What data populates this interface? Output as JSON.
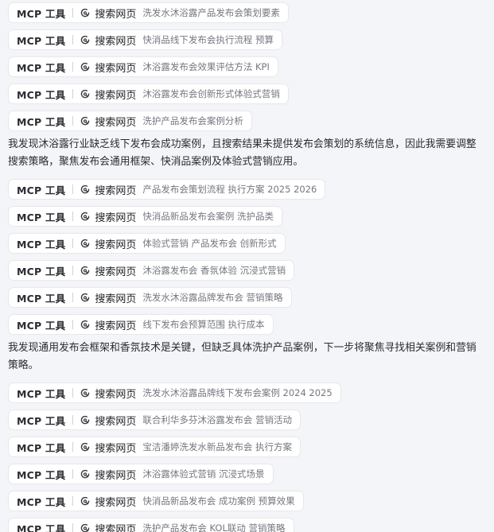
{
  "rows": [
    {
      "kind": "tool",
      "mcp": "MCP 工具",
      "action": "搜索网页",
      "query": "洗发水沐浴露产品发布会策划要素"
    },
    {
      "kind": "tool",
      "mcp": "MCP 工具",
      "action": "搜索网页",
      "query": "快消品线下发布会执行流程 预算"
    },
    {
      "kind": "tool",
      "mcp": "MCP 工具",
      "action": "搜索网页",
      "query": "沐浴露发布会效果评估方法 KPI"
    },
    {
      "kind": "tool",
      "mcp": "MCP 工具",
      "action": "搜索网页",
      "query": "沐浴露发布会创新形式体验式营销"
    },
    {
      "kind": "tool",
      "mcp": "MCP 工具",
      "action": "搜索网页",
      "query": "洗护产品发布会案例分析"
    },
    {
      "kind": "text",
      "text": "我发现沐浴露行业缺乏线下发布会成功案例，且搜索结果未提供发布会策划的系统信息，因此我需要调整搜索策略，聚焦发布会通用框架、快消品案例及体验式营销应用。"
    },
    {
      "kind": "tool",
      "mcp": "MCP 工具",
      "action": "搜索网页",
      "query": "产品发布会策划流程 执行方案 2025 2026"
    },
    {
      "kind": "tool",
      "mcp": "MCP 工具",
      "action": "搜索网页",
      "query": "快消品新品发布会案例 洗护品类"
    },
    {
      "kind": "tool",
      "mcp": "MCP 工具",
      "action": "搜索网页",
      "query": "体验式营销 产品发布会 创新形式"
    },
    {
      "kind": "tool",
      "mcp": "MCP 工具",
      "action": "搜索网页",
      "query": "沐浴露发布会 香氛体验 沉浸式营销"
    },
    {
      "kind": "tool",
      "mcp": "MCP 工具",
      "action": "搜索网页",
      "query": "洗发水沐浴露品牌发布会 营销策略"
    },
    {
      "kind": "tool",
      "mcp": "MCP 工具",
      "action": "搜索网页",
      "query": "线下发布会预算范围 执行成本"
    },
    {
      "kind": "text",
      "text": "我发现通用发布会框架和香氛技术是关键，但缺乏具体洗护产品案例，下一步将聚焦寻找相关案例和营销策略。"
    },
    {
      "kind": "tool",
      "mcp": "MCP 工具",
      "action": "搜索网页",
      "query": "洗发水沐浴露品牌线下发布会案例 2024 2025"
    },
    {
      "kind": "tool",
      "mcp": "MCP 工具",
      "action": "搜索网页",
      "query": "联合利华多芬沐浴露发布会 营销活动"
    },
    {
      "kind": "tool",
      "mcp": "MCP 工具",
      "action": "搜索网页",
      "query": "宝洁潘婷洗发水新品发布会 执行方案"
    },
    {
      "kind": "tool",
      "mcp": "MCP 工具",
      "action": "搜索网页",
      "query": "沐浴露体验式营销 沉浸式场景"
    },
    {
      "kind": "tool",
      "mcp": "MCP 工具",
      "action": "搜索网页",
      "query": "快消品新品发布会 成功案例 预算效果"
    },
    {
      "kind": "tool",
      "mcp": "MCP 工具",
      "action": "搜索网页",
      "query": "洗护产品发布会 KOL联动 营销策略"
    }
  ]
}
